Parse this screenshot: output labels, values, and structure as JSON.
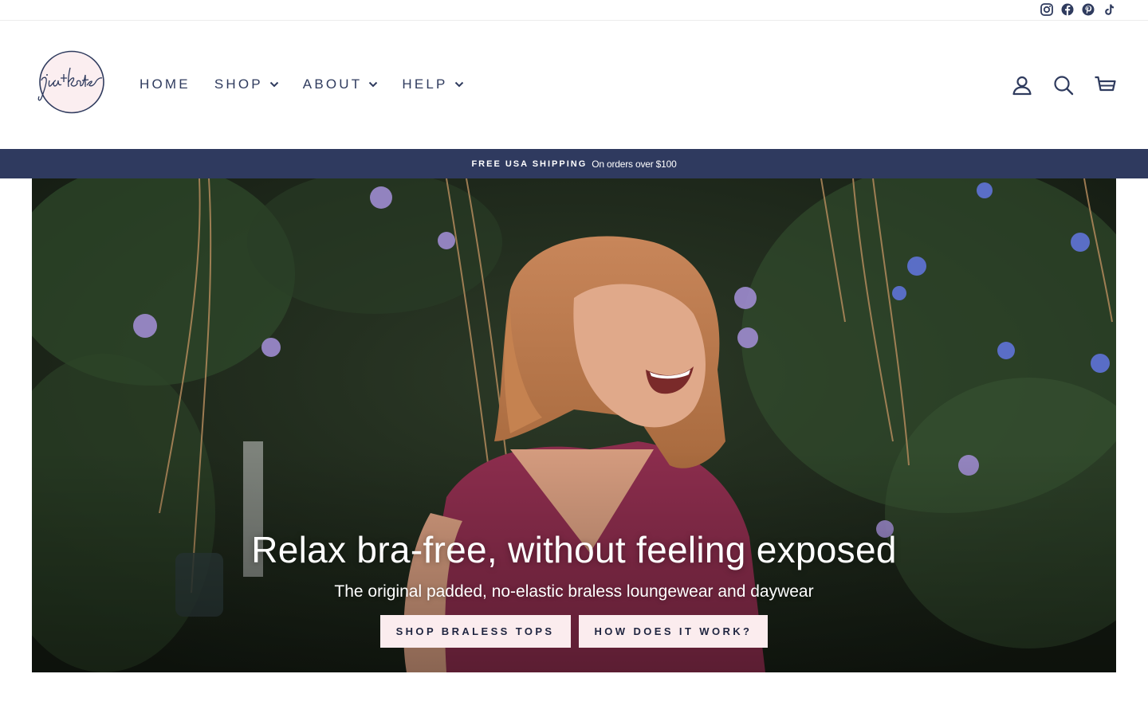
{
  "social": {
    "icons": [
      "instagram-icon",
      "facebook-icon",
      "pinterest-icon",
      "tiktok-icon"
    ]
  },
  "header": {
    "logo_text": "jia+kate",
    "nav": [
      {
        "label": "HOME",
        "has_dropdown": false
      },
      {
        "label": "SHOP",
        "has_dropdown": true
      },
      {
        "label": "ABOUT",
        "has_dropdown": true
      },
      {
        "label": "HELP",
        "has_dropdown": true
      }
    ],
    "icons": [
      "account-icon",
      "search-icon",
      "cart-icon"
    ]
  },
  "announcement": {
    "main": "FREE USA SHIPPING",
    "sub": "On orders over $100"
  },
  "hero": {
    "title": "Relax bra-free, without feeling exposed",
    "subtitle": "The original padded, no-elastic braless loungewear and daywear",
    "buttons": [
      "SHOP BRALESS TOPS",
      "HOW DOES IT WORK?"
    ]
  },
  "colors": {
    "brand_navy": "#2f3a5f",
    "button_pink": "#fbecee",
    "logo_fill": "#fbeef0"
  }
}
